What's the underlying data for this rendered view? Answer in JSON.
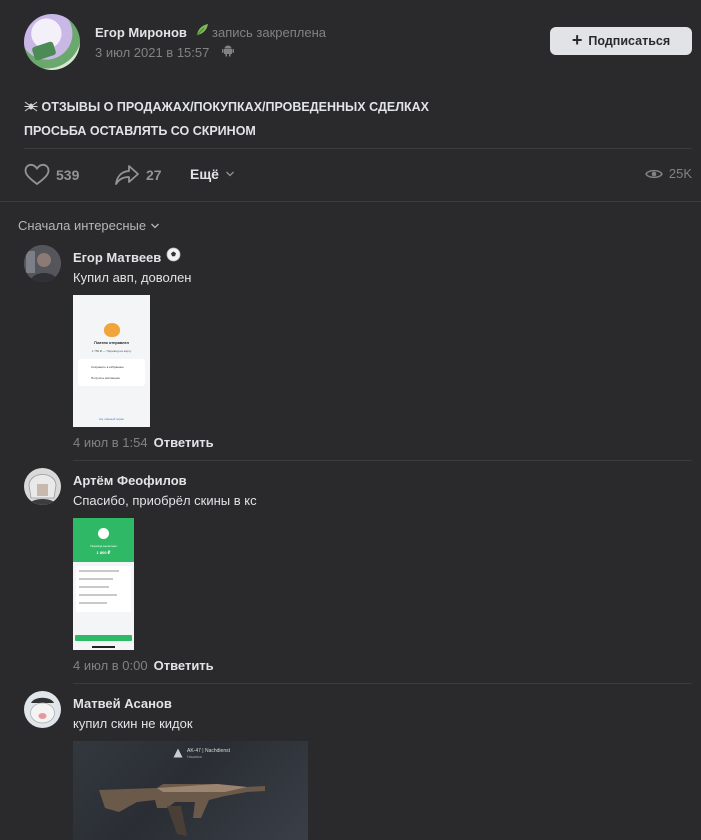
{
  "post": {
    "author": "Егор Миронов",
    "pinned": "запись закреплена",
    "date": "3 июл 2021 в 15:57",
    "subscribe_label": "Подписаться",
    "text_line1": "ОТЗЫВЫ О ПРОДАЖАХ/ПОКУПКАХ/ПРОВЕДЕННЫХ СДЕЛКАХ",
    "text_line2": "ПРОСЬБА ОСТАВЛЯТЬ СО СКРИНОМ",
    "likes": "539",
    "shares": "27",
    "more_label": "Ещё",
    "views": "25K"
  },
  "comments_sort": "Сначала интересные",
  "comments": [
    {
      "name": "Егор Матвеев",
      "text": "Купил авп, доволен",
      "date": "4 июл в 1:54",
      "reply": "Ответить",
      "shot": {
        "title": "Платеж отправлен",
        "amount": "1 750 ₽ — Перевод на карту",
        "row1": "Сохранить в избранное",
        "row2": "Получить квитанцию",
        "footer": "На главный экран"
      }
    },
    {
      "name": "Артём Феофилов",
      "text": "Спасибо, приобрёл скины в кс",
      "date": "4 июл в 0:00",
      "reply": "Ответить",
      "shot": {
        "title": "Перевод выполнен",
        "amount": "1 800 ₽"
      }
    },
    {
      "name": "Матвей Асанов",
      "text": "купил скин не кидок",
      "shot": {
        "title": "AK-47 | Nachdienst",
        "sub": "Нашивка"
      }
    }
  ],
  "colors": {
    "background": "#2a2a2c",
    "text": "#e1e3e6",
    "muted": "#828282",
    "divider": "#3c3c3e"
  }
}
